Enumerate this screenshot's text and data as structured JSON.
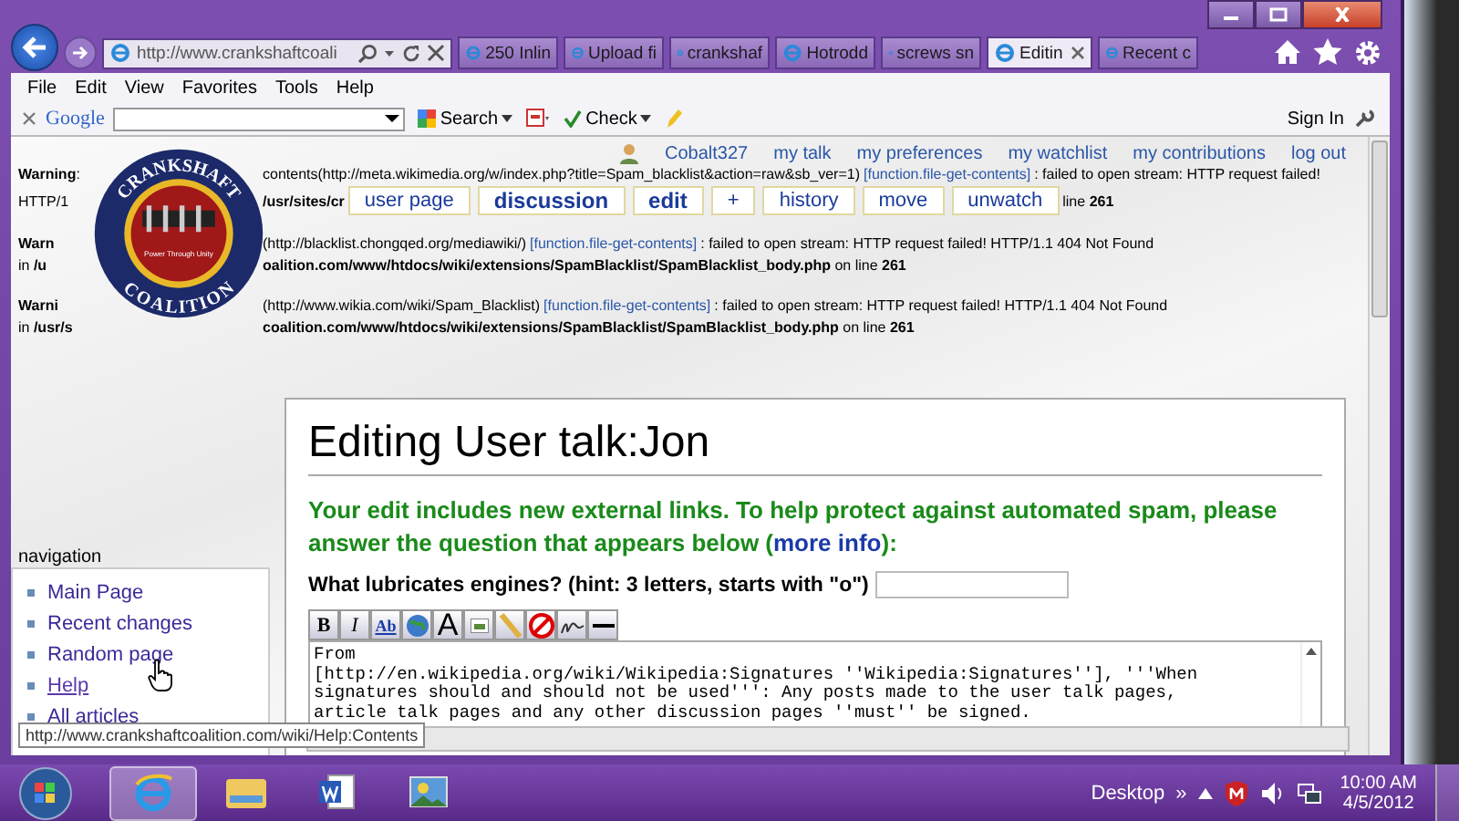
{
  "browser": {
    "address": "http://www.crankshaftcoali",
    "tabs": [
      {
        "label": "250 Inlin",
        "selected": false
      },
      {
        "label": "Upload fi",
        "selected": false
      },
      {
        "label": "crankshaf",
        "selected": false
      },
      {
        "label": "Hotrodd",
        "selected": false
      },
      {
        "label": "screws sn",
        "selected": false
      },
      {
        "label": "Editin",
        "selected": true
      },
      {
        "label": "Recent c",
        "selected": false
      }
    ],
    "menu": [
      "File",
      "Edit",
      "View",
      "Favorites",
      "Tools",
      "Help"
    ],
    "google_toolbar": {
      "logo": "Google",
      "search_button": "Search",
      "check_button": "Check",
      "sign_in": "Sign In"
    }
  },
  "page": {
    "personal_links": [
      "Cobalt327",
      "my talk",
      "my preferences",
      "my watchlist",
      "my contributions",
      "log out"
    ],
    "logo": {
      "top": "CRANKSHAFT",
      "bottom": "COALITION",
      "motto": "Power Through Unity"
    },
    "tabs": [
      {
        "label": "user page",
        "selected": false
      },
      {
        "label": "discussion",
        "selected": true
      },
      {
        "label": "edit",
        "selected": true
      },
      {
        "label": "+",
        "selected": false
      },
      {
        "label": "history",
        "selected": false
      },
      {
        "label": "move",
        "selected": false
      },
      {
        "label": "unwatch",
        "selected": false
      }
    ],
    "warnings": [
      [
        {
          "kind": "text",
          "text": "**Warning**:"
        },
        {
          "kind": "gap"
        },
        {
          "kind": "text",
          "text": "contents(http://meta.wikimedia.org/w/index.php?title=Spam_blacklist&action=raw&sb_ver=1)"
        },
        {
          "kind": "link",
          "text": "[function.file-get-contents]"
        },
        {
          "kind": "text",
          "text": ": failed to open stream: HTTP request failed!"
        }
      ],
      [
        {
          "kind": "text",
          "text": "HTTP/1"
        },
        {
          "kind": "gap"
        },
        {
          "kind": "text",
          "text": "**/usr/sites/cr**"
        },
        {
          "kind": "tabs"
        },
        {
          "kind": "text",
          "text": "line **261**"
        }
      ],
      [
        {
          "kind": "text",
          "text": "**Warn**"
        },
        {
          "kind": "gap"
        },
        {
          "kind": "text",
          "text": "(http://blacklist.chongqed.org/mediawiki/)"
        },
        {
          "kind": "link",
          "text": "[function.file-get-contents]"
        },
        {
          "kind": "text",
          "text": ": failed to open stream: HTTP request failed! HTTP/1.1 404 Not Found"
        }
      ],
      [
        {
          "kind": "text",
          "text": "in **/u**"
        },
        {
          "kind": "gap"
        },
        {
          "kind": "text",
          "text": "**oalition.com/www/htdocs/wiki/extensions/SpamBlacklist/SpamBlacklist_body.php** on line **261**"
        }
      ],
      [
        {
          "kind": "text",
          "text": "**Warni**"
        },
        {
          "kind": "gap"
        },
        {
          "kind": "text",
          "text": "(http://www.wikia.com/wiki/Spam_Blacklist)"
        },
        {
          "kind": "link",
          "text": "[function.file-get-contents]"
        },
        {
          "kind": "text",
          "text": ": failed to open stream: HTTP request failed! HTTP/1.1 404 Not Found"
        }
      ],
      [
        {
          "kind": "text",
          "text": "in **/usr/s**"
        },
        {
          "kind": "gap"
        },
        {
          "kind": "text",
          "text": "**coalition.com/www/htdocs/wiki/extensions/SpamBlacklist/SpamBlacklist_body.php** on line **261**"
        }
      ]
    ],
    "sidebar": {
      "heading": "navigation",
      "items": [
        {
          "label": "Main Page",
          "hovered": false
        },
        {
          "label": "Recent changes",
          "hovered": false
        },
        {
          "label": "Random page",
          "hovered": false
        },
        {
          "label": "Help",
          "hovered": true
        },
        {
          "label": "All articles",
          "hovered": false
        }
      ]
    },
    "content": {
      "title": "Editing User talk:Jon",
      "notice_before": "Your edit includes new external links. To help protect against automated spam, please answer the question that appears below (",
      "notice_link": "more info",
      "notice_after": "):",
      "question": "What lubricates engines? (hint: 3 letters, starts with \"o\")",
      "edit_toolbar": [
        {
          "kind": "bold",
          "glyph": "B"
        },
        {
          "kind": "italic",
          "glyph": "I"
        },
        {
          "kind": "link",
          "glyph": "Ab"
        },
        {
          "kind": "globe"
        },
        {
          "kind": "headline",
          "glyph": "A"
        },
        {
          "kind": "image"
        },
        {
          "kind": "media"
        },
        {
          "kind": "nowiki"
        },
        {
          "kind": "signature"
        },
        {
          "kind": "rule"
        }
      ],
      "textarea": "From\n[http://en.wikipedia.org/wiki/Wikipedia:Signatures ''Wikipedia:Signatures''], '''When\nsignatures should and should not be used''': Any posts made to the user talk pages,\narticle talk pages and any other discussion pages ''must'' be signed."
    },
    "status_tooltip": "http://www.crankshaftcoalition.com/wiki/Help:Contents"
  },
  "taskbar": {
    "apps": [
      {
        "kind": "ie",
        "active": true
      },
      {
        "kind": "explorer",
        "active": false
      },
      {
        "kind": "word",
        "active": false
      },
      {
        "kind": "photo",
        "active": false
      }
    ],
    "desktop_label": "Desktop",
    "overflow": "»",
    "time": "10:00 AM",
    "date": "4/5/2012"
  }
}
